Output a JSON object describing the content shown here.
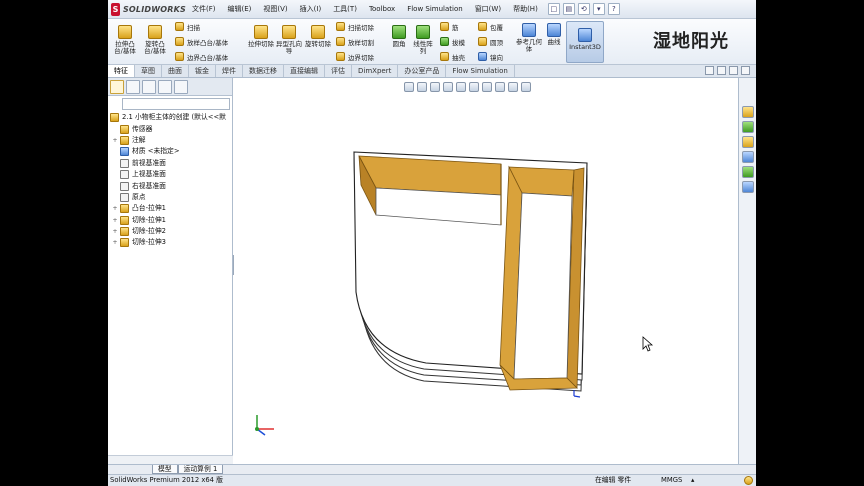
{
  "app": {
    "logo_letter": "S",
    "logo_text": "SOLIDWORKS",
    "menu": [
      "文件(F)",
      "编辑(E)",
      "视图(V)",
      "插入(I)",
      "工具(T)",
      "Toolbox",
      "Flow Simulation",
      "窗口(W)",
      "帮助(H)"
    ],
    "quick_access": [
      "□",
      "▤",
      "⟲",
      "▾",
      "?"
    ]
  },
  "ribbon": {
    "big_buttons": [
      {
        "label": "拉伸凸台/基体",
        "icon": "extruded-boss-icon"
      },
      {
        "label": "旋转凸台/基体",
        "icon": "revolved-boss-icon"
      },
      {
        "label": "拉伸切除",
        "icon": "extruded-cut-icon"
      },
      {
        "label": "异型孔向导",
        "icon": "hole-wizard-icon"
      },
      {
        "label": "旋转切除",
        "icon": "revolved-cut-icon"
      },
      {
        "label": "圆角",
        "icon": "fillet-icon"
      },
      {
        "label": "线性阵列",
        "icon": "linear-pattern-icon"
      },
      {
        "label": "参考几何体",
        "icon": "reference-geometry-icon"
      },
      {
        "label": "曲线",
        "icon": "curves-icon"
      },
      {
        "label": "Instant3D",
        "icon": "instant3d-icon"
      }
    ],
    "small_buttons": [
      {
        "label": "扫描",
        "icon": "sweep-icon"
      },
      {
        "label": "放样凸台/基体",
        "icon": "loft-icon"
      },
      {
        "label": "边界凸台/基体",
        "icon": "boundary-boss-icon"
      },
      {
        "label": "扫描切除",
        "icon": "swept-cut-icon"
      },
      {
        "label": "放样切割",
        "icon": "lofted-cut-icon"
      },
      {
        "label": "边界切除",
        "icon": "boundary-cut-icon"
      },
      {
        "label": "筋",
        "icon": "rib-icon"
      },
      {
        "label": "拔模",
        "icon": "draft-icon"
      },
      {
        "label": "抽壳",
        "icon": "shell-icon"
      },
      {
        "label": "包覆",
        "icon": "wrap-icon"
      },
      {
        "label": "圆顶",
        "icon": "dome-icon"
      },
      {
        "label": "镜向",
        "icon": "mirror-icon"
      }
    ],
    "watermark": "湿地阳光"
  },
  "tabs": [
    "特征",
    "草图",
    "曲面",
    "钣金",
    "焊件",
    "数据迁移",
    "直接编辑",
    "评估",
    "DimXpert",
    "办公室产品",
    "Flow Simulation"
  ],
  "active_tab": "特征",
  "tree": {
    "root": "2.1 小物柜主体的创建 (默认<<默",
    "items": [
      {
        "label": "传感器",
        "exp": ""
      },
      {
        "label": "注解",
        "exp": "+"
      },
      {
        "label": "材质 <未指定>",
        "exp": ""
      },
      {
        "label": "前视基准面",
        "exp": ""
      },
      {
        "label": "上视基准面",
        "exp": ""
      },
      {
        "label": "右视基准面",
        "exp": ""
      },
      {
        "label": "原点",
        "exp": ""
      },
      {
        "label": "凸台-拉伸1",
        "exp": "+"
      },
      {
        "label": "切除-拉伸1",
        "exp": "+"
      },
      {
        "label": "切除-拉伸2",
        "exp": "+"
      },
      {
        "label": "切除-拉伸3",
        "exp": "+"
      }
    ]
  },
  "sheet_tabs": [
    "模型",
    "运动算例 1"
  ],
  "status": {
    "product": "SolidWorks Premium 2012 x64 版",
    "mode": "在编辑 零件",
    "units": "MMGS",
    "arrow": "▴"
  },
  "colors": {
    "wood": "#d9a23b",
    "wood_dark": "#b98226",
    "accent": "#c8102e"
  }
}
